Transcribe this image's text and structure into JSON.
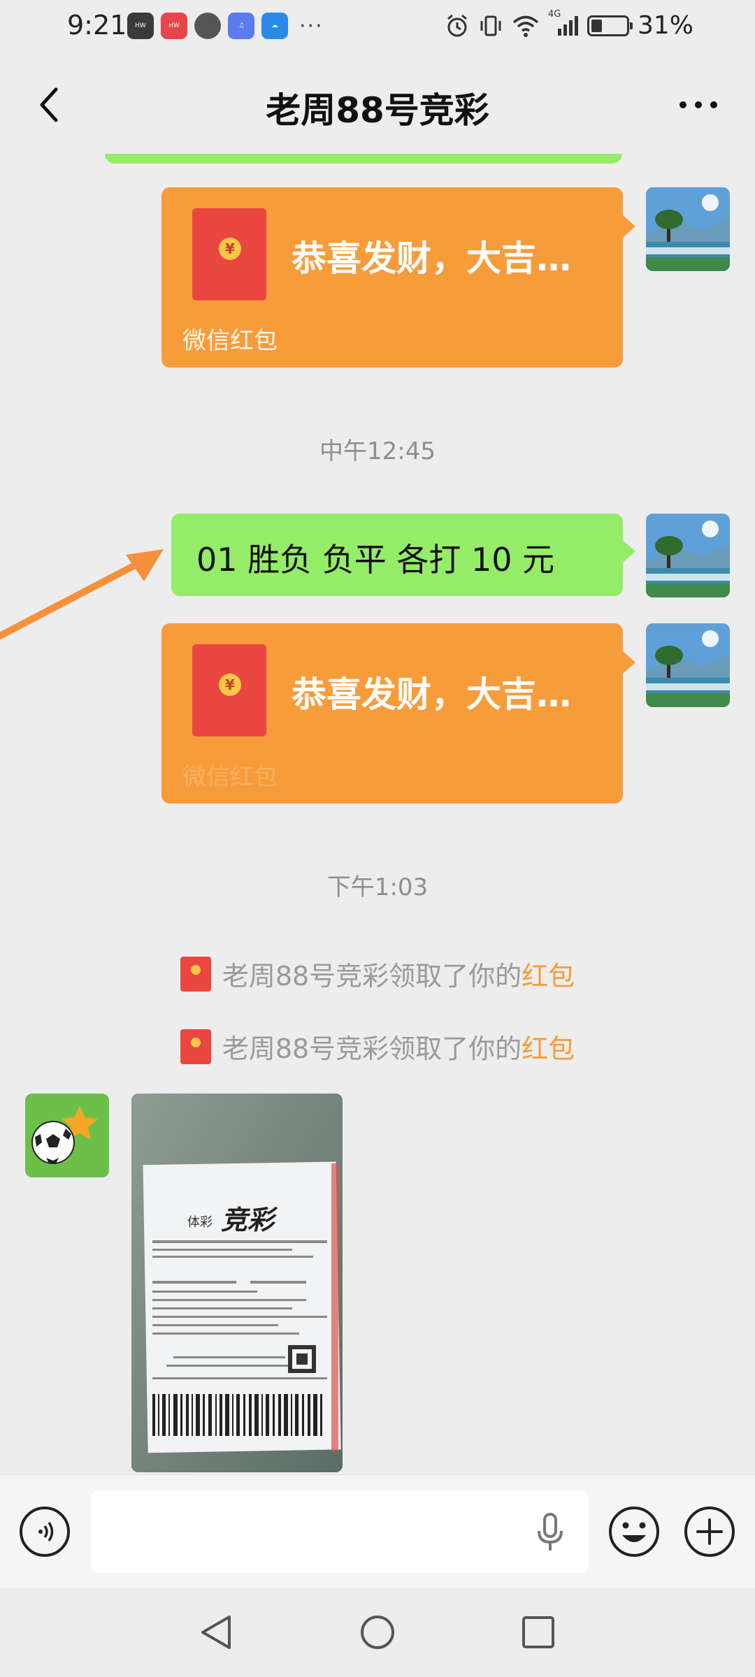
{
  "status_bar": {
    "time": "9:21",
    "app_icons": [
      "huawei-appgallery-icon",
      "vmall-icon",
      "browser-icon",
      "music-icon",
      "weather-icon"
    ],
    "more_indicator": "···",
    "network": "4G",
    "battery_percent": "31%",
    "battery_level": 0.31
  },
  "header": {
    "title": "老周88号竞彩"
  },
  "messages": {
    "red_packet_1": {
      "text": "恭喜发财，大吉…",
      "footer": "微信红包",
      "coin": "¥"
    },
    "time_1": "中午12:45",
    "text_msg": "01  胜负  负平  各打 10 元",
    "red_packet_2": {
      "text": "恭喜发财，大吉…",
      "footer": "微信红包",
      "coin": "¥"
    },
    "time_2": "下午1:03",
    "system_1": {
      "prefix": "老周88号竞彩领取了你的",
      "link": "红包"
    },
    "system_2": {
      "prefix": "老周88号竞彩领取了你的",
      "link": "红包"
    },
    "ticket_photo": {
      "brand_small": "体彩",
      "brand_big": "竞彩"
    }
  },
  "colors": {
    "bubble_green": "#95ec69",
    "red_packet_orange": "#f79c3b",
    "red_packet_red": "#e9473f",
    "background": "#ededed"
  }
}
